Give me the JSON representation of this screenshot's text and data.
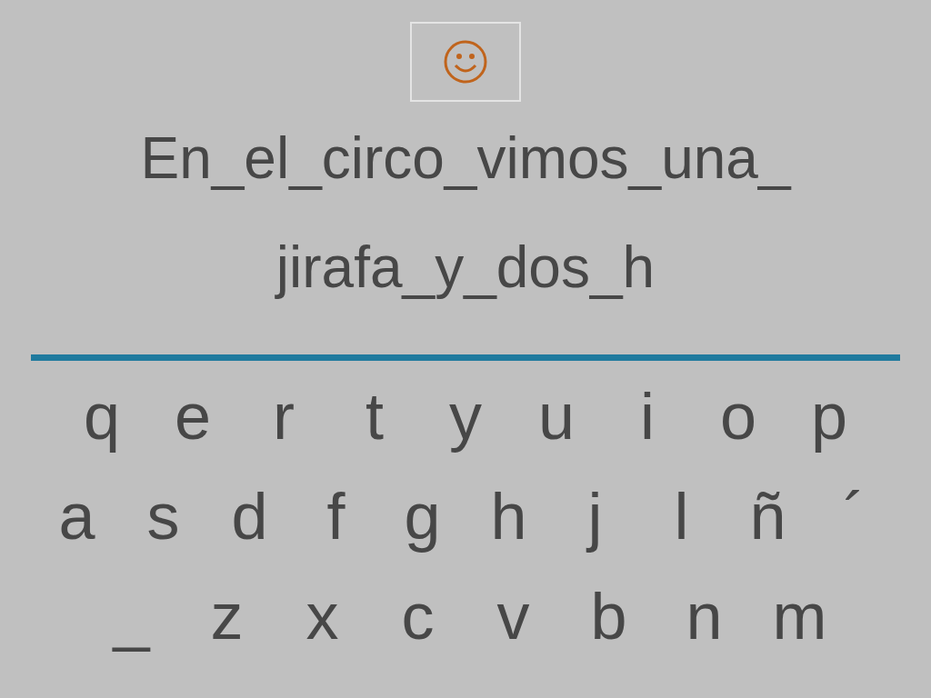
{
  "sentence_lines": [
    "En_el_circo_vimos_una_",
    "jirafa_y_dos_h"
  ],
  "keyboard_rows": [
    [
      "q",
      "e",
      "r",
      "t",
      "y",
      "u",
      "i",
      "o",
      "p"
    ],
    [
      "a",
      "s",
      "d",
      "f",
      "g",
      "h",
      "j",
      "l",
      "ñ",
      "´"
    ],
    [
      "_",
      "z",
      "x",
      "c",
      "v",
      "b",
      "n",
      "m"
    ]
  ]
}
